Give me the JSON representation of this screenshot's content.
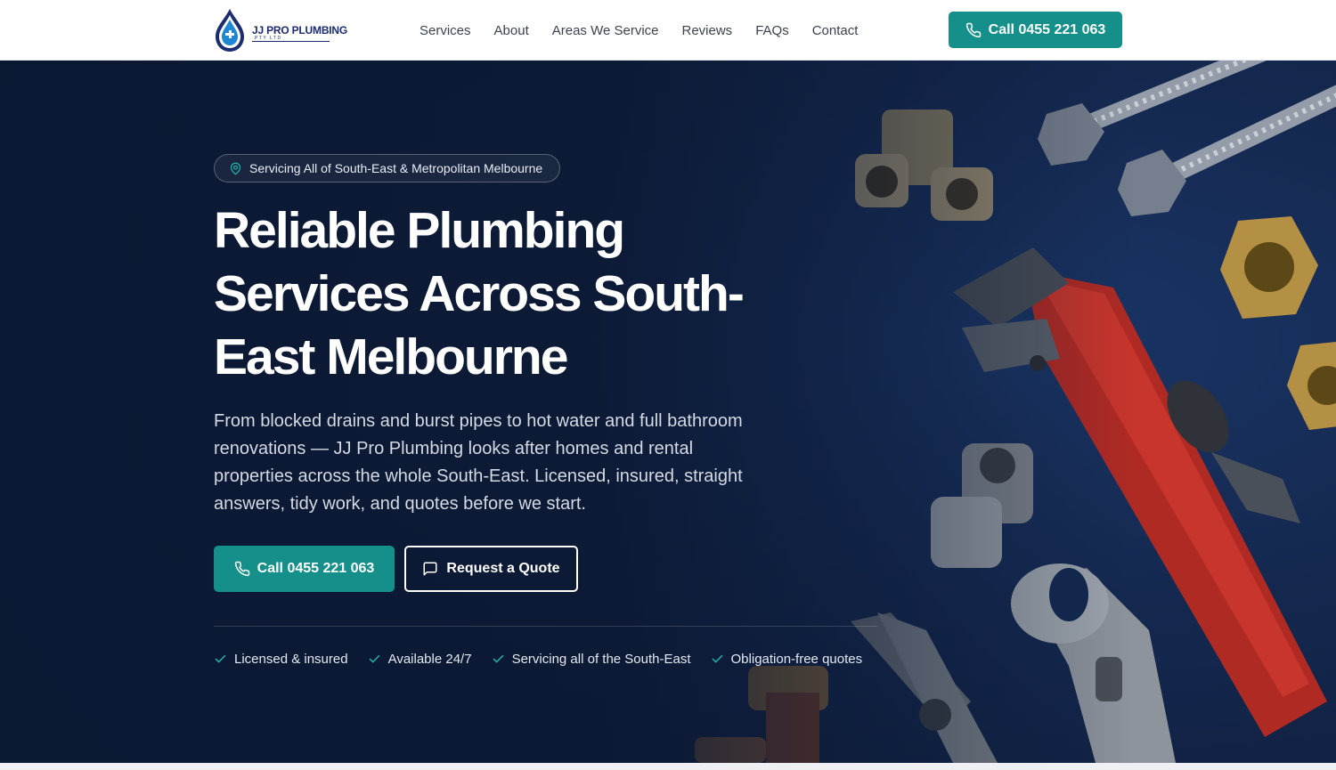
{
  "brand": {
    "name": "JJ PRO PLUMBING",
    "sub": "PTY LTD",
    "colors": {
      "navy": "#1c2c6e",
      "teal": "#158f89",
      "hero": "#14284f"
    }
  },
  "nav": {
    "items": [
      {
        "label": "Services"
      },
      {
        "label": "About"
      },
      {
        "label": "Areas We Service"
      },
      {
        "label": "Reviews"
      },
      {
        "label": "FAQs"
      },
      {
        "label": "Contact"
      }
    ],
    "call_label": "Call 0455 221 063",
    "call_icon": "phone-icon"
  },
  "hero": {
    "badge": {
      "icon": "map-pin-icon",
      "text": "Servicing All of South-East & Metropolitan Melbourne"
    },
    "headline": "Reliable Plumbing Services Across South-East Melbourne",
    "lead": "From blocked drains and burst pipes to hot water and full bathroom renovations — JJ Pro Plumbing looks after homes and rental properties across the whole South-East. Licensed, insured, straight answers, tidy work, and quotes before we start.",
    "buttons": {
      "call": {
        "label": "Call 0455 221 063",
        "icon": "phone-icon"
      },
      "quote": {
        "label": "Request a Quote",
        "icon": "chat-bubble-icon"
      }
    },
    "features": [
      {
        "label": "Licensed & insured",
        "icon": "check-icon"
      },
      {
        "label": "Available 24/7",
        "icon": "check-icon"
      },
      {
        "label": "Servicing all of the South-East",
        "icon": "check-icon"
      },
      {
        "label": "Obligation-free quotes",
        "icon": "check-icon"
      }
    ]
  }
}
